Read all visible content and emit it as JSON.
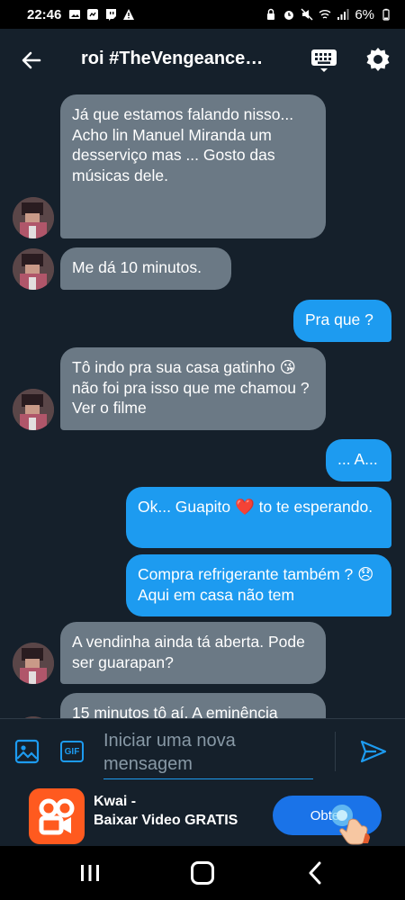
{
  "status_bar": {
    "time": "22:46",
    "battery": "6%"
  },
  "header": {
    "title": "roi #TheVengeance…"
  },
  "messages": [
    {
      "side": "in",
      "text": "Já que estamos falando nisso...\nAcho lin Manuel Miranda um desserviço mas ... Gosto das músicas dele.",
      "avatar": true
    },
    {
      "side": "in",
      "text": "Me  dá 10 minutos.",
      "avatar": true
    },
    {
      "side": "out",
      "text": "Pra que ?"
    },
    {
      "side": "in",
      "text": "Tô indo pra sua casa gatinho 😘 não foi pra isso que me chamou ? Ver o filme",
      "avatar": true
    },
    {
      "side": "out",
      "text": "... A..."
    },
    {
      "side": "out",
      "text": "Ok... Guapito ❤️ to te esperando."
    },
    {
      "side": "out",
      "text": "Compra refrigerante também ? 😞 Aqui em casa não tem"
    },
    {
      "side": "in",
      "text": "A vendinha ainda tá aberta. Pode ser guarapan?",
      "avatar": true
    },
    {
      "side": "in",
      "text": "15 minutos tô aí. A eminência",
      "avatar": true
    }
  ],
  "composer": {
    "placeholder": "Iniciar uma nova mensagem",
    "gif_label": "GIF"
  },
  "ad": {
    "title_line1": "Kwai -",
    "title_line2": "Baixar Video GRATIS",
    "button_label": "Obter"
  },
  "colors": {
    "background": "#15202b",
    "incoming_bubble": "#6b7985",
    "outgoing_bubble": "#1d9bf0",
    "accent": "#1d9bf0",
    "ad_brand": "#ff5a1f"
  },
  "icons": {
    "status_left": [
      "photo-icon",
      "messenger-icon",
      "twitch-icon",
      "alert-icon"
    ],
    "status_right": [
      "lock-icon",
      "alarm-icon",
      "mute-icon",
      "wifi-icon",
      "signal-icon",
      "battery-icon"
    ]
  }
}
